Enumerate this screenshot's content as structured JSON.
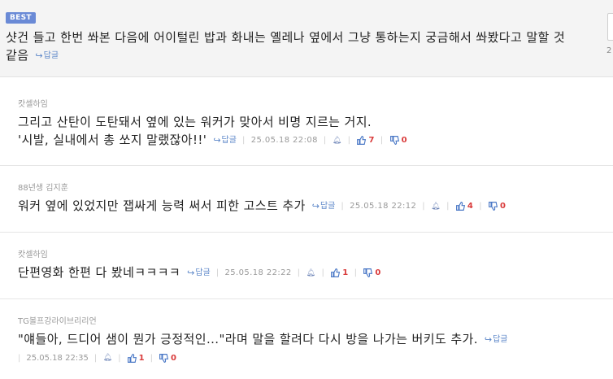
{
  "best": {
    "badge": "BEST",
    "text": "샷건 들고 한번 쏴본 다음에 어이털린 밥과 화내는 옐레나 옆에서 그냥 통하는지 궁금해서 쏴봤다고 말할 것 같음",
    "reply_label": "답글",
    "side_count": "2"
  },
  "comments": [
    {
      "author": "캇셀하임",
      "lines": [
        "그리고 산탄이 도탄돼서 옆에 있는 워커가 맞아서 비명 지르는 거지.",
        "'시발, 실내에서 총 쏘지 말랬잖아!!'"
      ],
      "reply_label": "답글",
      "date": "25.05.18 22:08",
      "likes": "7",
      "dislikes": "0"
    },
    {
      "author": "88년생 김지훈",
      "lines": [
        "워커 옆에 있었지만 잽싸게 능력 써서 피한 고스트 추가"
      ],
      "reply_label": "답글",
      "date": "25.05.18 22:12",
      "likes": "4",
      "dislikes": "0"
    },
    {
      "author": "캇셀하임",
      "lines": [
        "단편영화 한편 다 봤네ㅋㅋㅋㅋ"
      ],
      "reply_label": "답글",
      "date": "25.05.18 22:22",
      "likes": "1",
      "dislikes": "0"
    },
    {
      "author": "TG볼프강라이브리리언",
      "lines": [
        "\"얘들아, 드디어 샘이 뭔가 긍정적인...\"라며 말을 할려다 다시 방을 나가는 버키도 추가."
      ],
      "reply_label": "답글",
      "date": "25.05.18 22:35",
      "likes": "1",
      "dislikes": "0"
    }
  ],
  "colors": {
    "accent": "#5b86c8",
    "badge": "#6a8ad6",
    "count": "#d93a3a"
  }
}
